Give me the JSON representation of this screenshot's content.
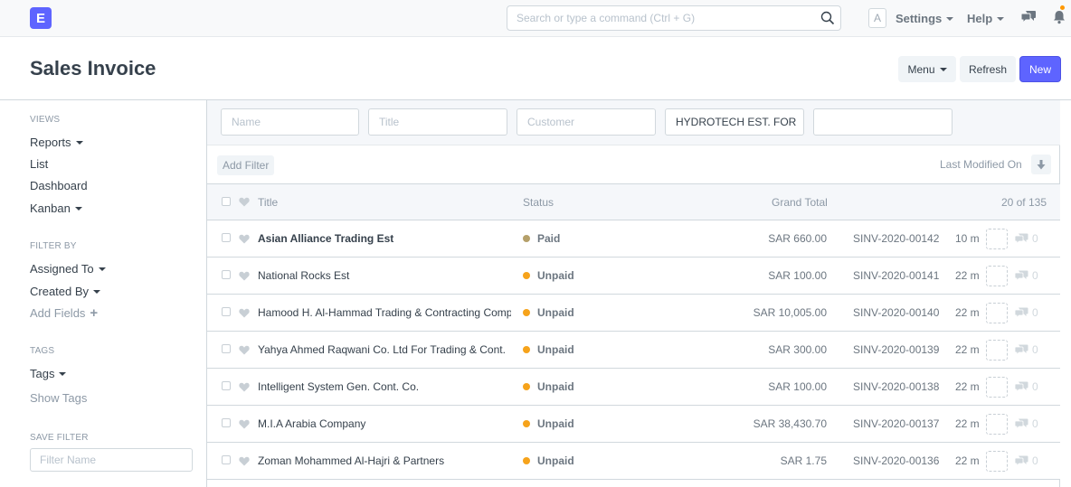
{
  "navbar": {
    "logo_letter": "E",
    "search_placeholder": "Search or type a command (Ctrl + G)",
    "avatar_letter": "A",
    "settings_label": "Settings",
    "help_label": "Help"
  },
  "page": {
    "title": "Sales Invoice",
    "menu_label": "Menu",
    "refresh_label": "Refresh",
    "new_label": "New"
  },
  "sidebar": {
    "views_heading": "VIEWS",
    "reports": "Reports",
    "list": "List",
    "dashboard": "Dashboard",
    "kanban": "Kanban",
    "filter_heading": "FILTER BY",
    "assigned_to": "Assigned To",
    "created_by": "Created By",
    "add_fields": "Add Fields",
    "tags_heading": "TAGS",
    "tags": "Tags",
    "show_tags": "Show Tags",
    "save_filter_heading": "SAVE FILTER",
    "filter_name_placeholder": "Filter Name"
  },
  "filters": {
    "name_placeholder": "Name",
    "title_placeholder": "Title",
    "customer_placeholder": "Customer",
    "customer_value": "HYDROTECH EST. FOR EC",
    "extra_value": "",
    "add_filter": "Add Filter",
    "sort_label": "Last Modified On"
  },
  "list": {
    "col_title": "Title",
    "col_status": "Status",
    "col_total": "Grand Total",
    "count": "20 of 135",
    "colors": {
      "paid": "#b5a06a",
      "unpaid": "#f6a31b"
    },
    "rows": [
      {
        "title": "Asian Alliance Trading Est",
        "bold": true,
        "status": "Paid",
        "status_key": "paid",
        "total": "SAR 660.00",
        "invoice": "SINV-2020-00142",
        "modified": "10 m",
        "comments": "0"
      },
      {
        "title": "National Rocks Est",
        "bold": false,
        "status": "Unpaid",
        "status_key": "unpaid",
        "total": "SAR 100.00",
        "invoice": "SINV-2020-00141",
        "modified": "22 m",
        "comments": "0"
      },
      {
        "title": "Hamood H. Al-Hammad Trading & Contracting Company",
        "bold": false,
        "status": "Unpaid",
        "status_key": "unpaid",
        "total": "SAR 10,005.00",
        "invoice": "SINV-2020-00140",
        "modified": "22 m",
        "comments": "0"
      },
      {
        "title": "Yahya Ahmed Raqwani Co. Ltd For Trading & Cont.",
        "bold": false,
        "status": "Unpaid",
        "status_key": "unpaid",
        "total": "SAR 300.00",
        "invoice": "SINV-2020-00139",
        "modified": "22 m",
        "comments": "0"
      },
      {
        "title": "Intelligent System Gen. Cont. Co.",
        "bold": false,
        "status": "Unpaid",
        "status_key": "unpaid",
        "total": "SAR 100.00",
        "invoice": "SINV-2020-00138",
        "modified": "22 m",
        "comments": "0"
      },
      {
        "title": "M.I.A Arabia Company",
        "bold": false,
        "status": "Unpaid",
        "status_key": "unpaid",
        "total": "SAR 38,430.70",
        "invoice": "SINV-2020-00137",
        "modified": "22 m",
        "comments": "0"
      },
      {
        "title": "Zoman Mohammed Al-Hajri & Partners",
        "bold": false,
        "status": "Unpaid",
        "status_key": "unpaid",
        "total": "SAR 1.75",
        "invoice": "SINV-2020-00136",
        "modified": "22 m",
        "comments": "0"
      }
    ]
  }
}
